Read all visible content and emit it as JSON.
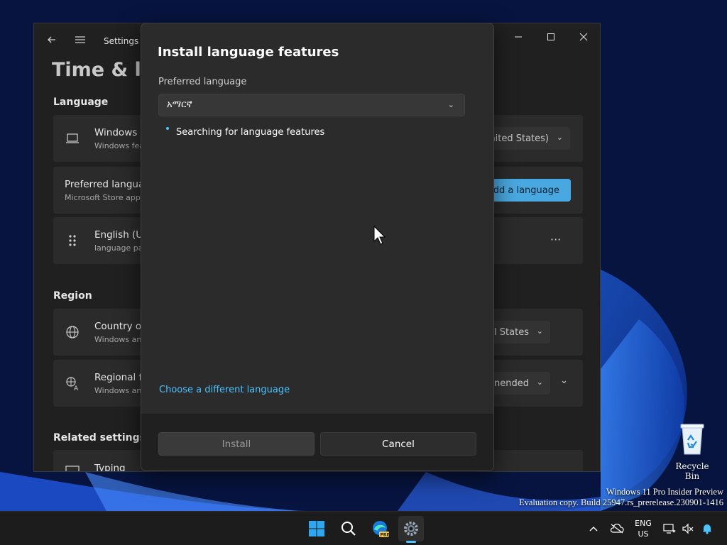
{
  "settings": {
    "app_title": "Settings",
    "page_title": "Time & lar",
    "sections": {
      "language": "Language",
      "region": "Region",
      "related": "Related settings"
    },
    "cards": {
      "windows_display": {
        "title": "Windows d",
        "sub": "Windows fea",
        "combo_value": "nited States)"
      },
      "preferred": {
        "title": "Preferred languag",
        "sub": "Microsoft Store app",
        "button_label": "Add a language"
      },
      "english": {
        "title": "English (Ur",
        "sub": "language pa",
        "more": "···"
      },
      "country": {
        "title": "Country or",
        "sub": "Windows an",
        "combo_value": "l States"
      },
      "regional": {
        "title": "Regional fo",
        "sub": "Windows an",
        "combo_value": "nended"
      },
      "typing": {
        "title": "Typing"
      }
    }
  },
  "dialog": {
    "title": "Install language features",
    "preferred_label": "Preferred language",
    "selected_language": "አማርኛ",
    "status": "Searching for language features",
    "link": "Choose a different language",
    "install_label": "Install",
    "cancel_label": "Cancel"
  },
  "desktop": {
    "recycle_bin": "Recycle Bin",
    "watermark_line1": "Windows 11 Pro Insider Preview",
    "watermark_line2": "Evaluation copy. Build 25947.rs_prerelease.230901-1416"
  },
  "taskbar": {
    "lang_line1": "ENG",
    "lang_line2": "US",
    "pinned": [
      "start-icon",
      "search-icon",
      "edge-icon",
      "settings-icon"
    ]
  },
  "colors": {
    "accent": "#4cc2ff",
    "dialog_bg": "#2b2b2b",
    "window_bg": "#202020",
    "desktop_bg": "#0a1a4a"
  }
}
